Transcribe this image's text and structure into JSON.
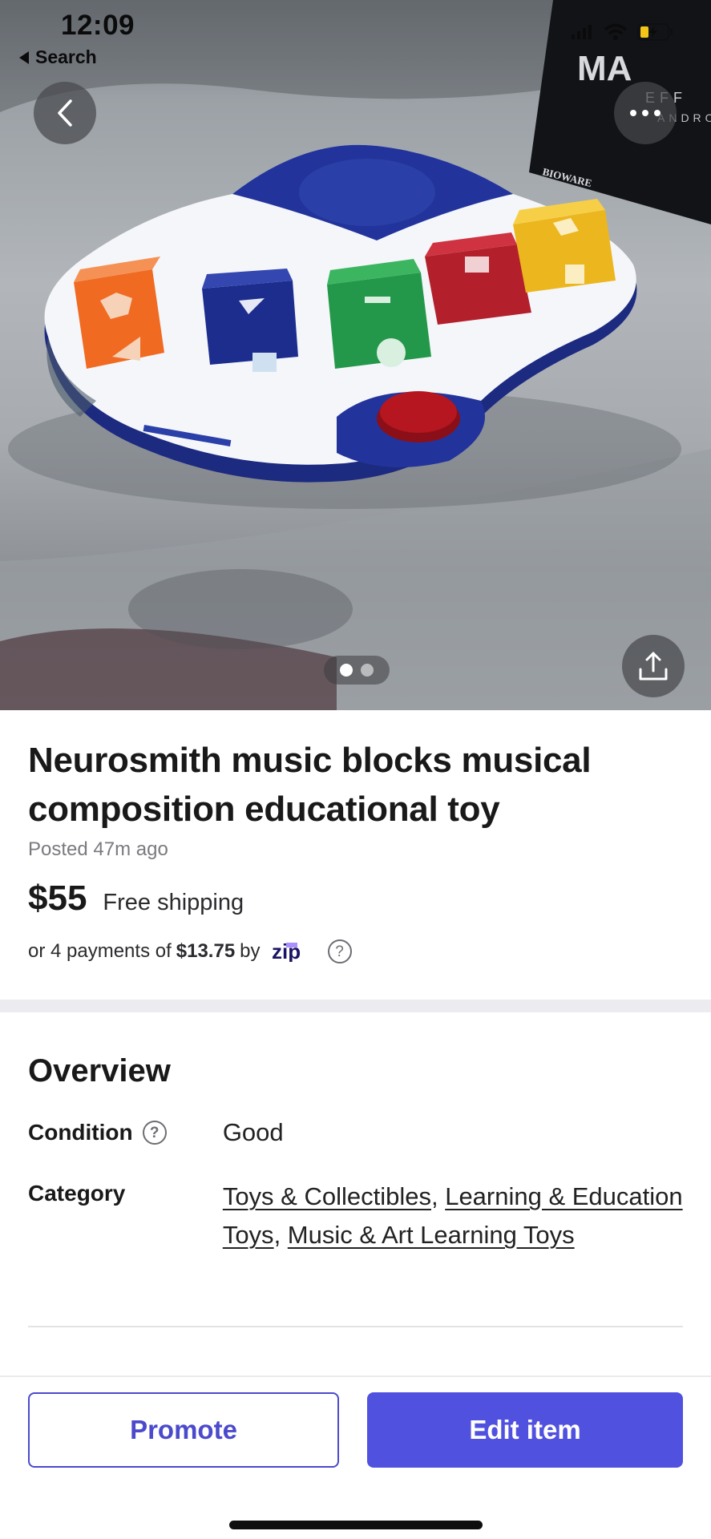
{
  "status_bar": {
    "time": "12:09",
    "back_app": "Search"
  },
  "gallery": {
    "photo_count": 2,
    "active_index": 0,
    "box_brand_text": "BIOWARE",
    "box_title_fragment": "MA",
    "box_subtitle_fragment": "EFF",
    "box_subtitle2_fragment": "ANDRO"
  },
  "listing": {
    "title": "Neurosmith music blocks musical composition educational toy",
    "posted": "Posted 47m ago",
    "price": "$55",
    "shipping": "Free shipping",
    "installment_prefix": "or 4 payments of",
    "installment_amount": "$13.75",
    "installment_by": "by",
    "installment_provider": "zip",
    "help_symbol": "?"
  },
  "overview": {
    "heading": "Overview",
    "condition_label": "Condition",
    "condition_value": "Good",
    "category_label": "Category",
    "categories": [
      "Toys & Collectibles",
      "Learning & Education Toys",
      "Music & Art Learning Toys"
    ],
    "category_separator": ", "
  },
  "actions": {
    "promote_label": "Promote",
    "edit_label": "Edit item"
  },
  "colors": {
    "accent": "#5151df",
    "accent_outline": "#4b4acc",
    "divider": "#ececf0"
  },
  "icons": {
    "back": "chevron-left-icon",
    "more": "ellipsis-icon",
    "share": "share-icon",
    "help": "question-circle-icon"
  }
}
